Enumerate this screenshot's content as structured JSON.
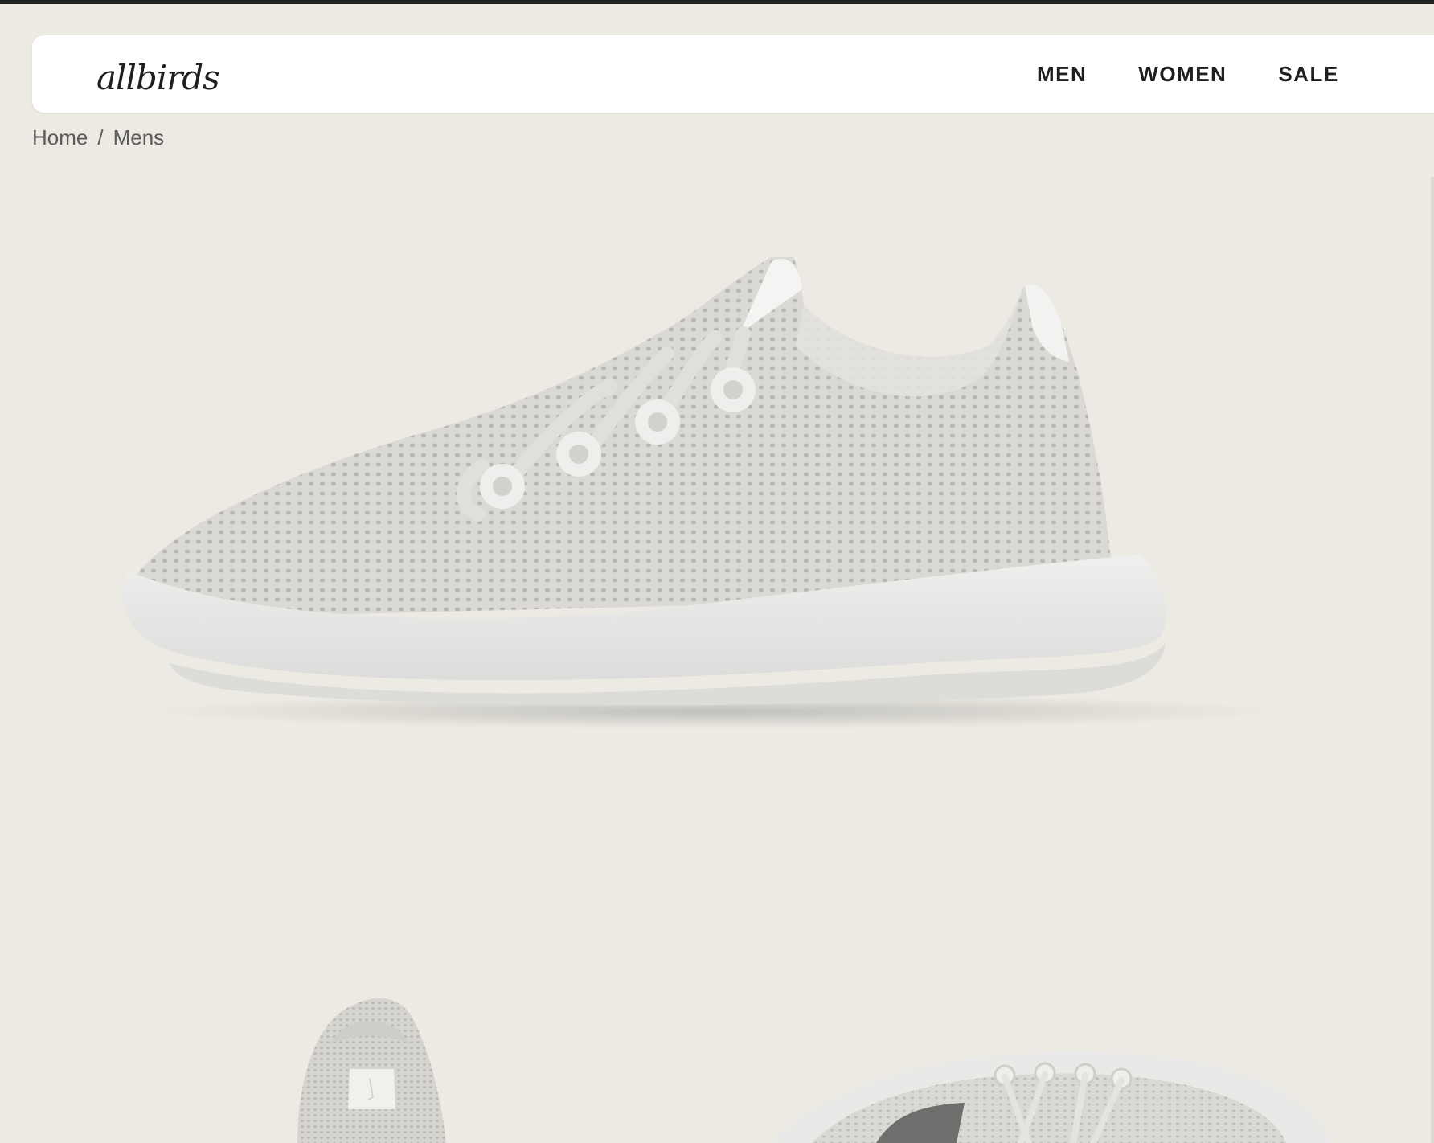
{
  "brand": {
    "logo_text": "allbirds"
  },
  "nav": {
    "links": [
      {
        "label": "MEN"
      },
      {
        "label": "WOMEN"
      },
      {
        "label": "SALE"
      }
    ]
  },
  "breadcrumb": {
    "items": [
      {
        "label": "Home"
      },
      {
        "label": "Mens"
      }
    ],
    "separator": "/"
  },
  "colors": {
    "page_bg": "#ECEAE3",
    "nav_bg": "#FFFFFF",
    "text_dark": "#1F1F1F",
    "text_muted": "#5B5B5B",
    "shoe_knit": "#D9D8D4",
    "shoe_sole": "#E6E6E4"
  },
  "icons": {
    "hero": "shoe-side-icon",
    "thumb_back": "shoe-back-icon",
    "thumb_top": "shoe-top-icon"
  }
}
